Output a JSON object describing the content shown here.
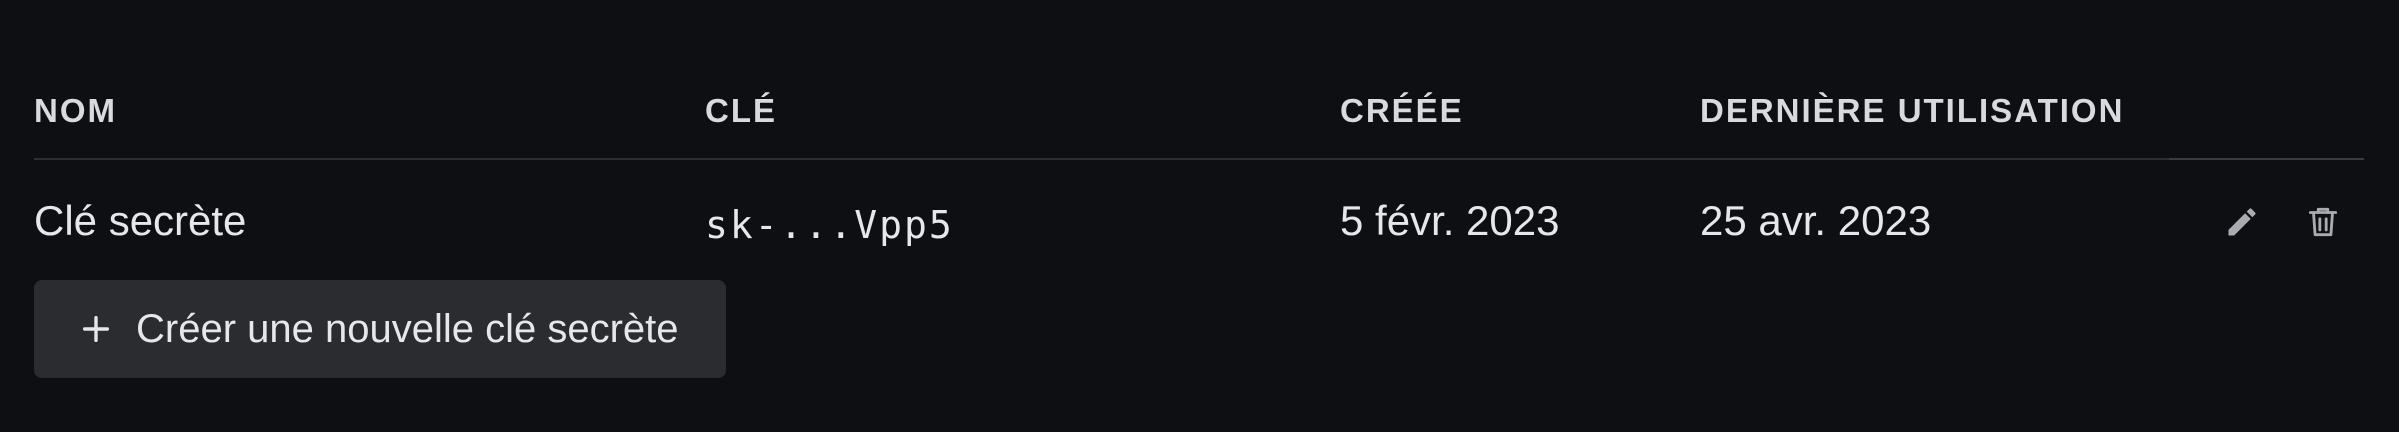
{
  "table": {
    "headers": {
      "name": "NOM",
      "key": "CLÉ",
      "created": "CRÉÉE",
      "last_used": "DERNIÈRE UTILISATION"
    },
    "rows": [
      {
        "name": "Clé secrète",
        "key": "sk-...Vpp5",
        "created": "5 févr. 2023",
        "last_used": "25 avr. 2023",
        "actions": [
          "pencil-icon",
          "trash-icon"
        ]
      }
    ]
  },
  "create_button": {
    "label": "Créer une nouvelle clé secrète",
    "icon": "plus-icon"
  },
  "colors": {
    "background": "#0e0f12",
    "button_bg": "#2b2c30",
    "text": "#e6e7ea",
    "icon": "#a9abb0"
  }
}
